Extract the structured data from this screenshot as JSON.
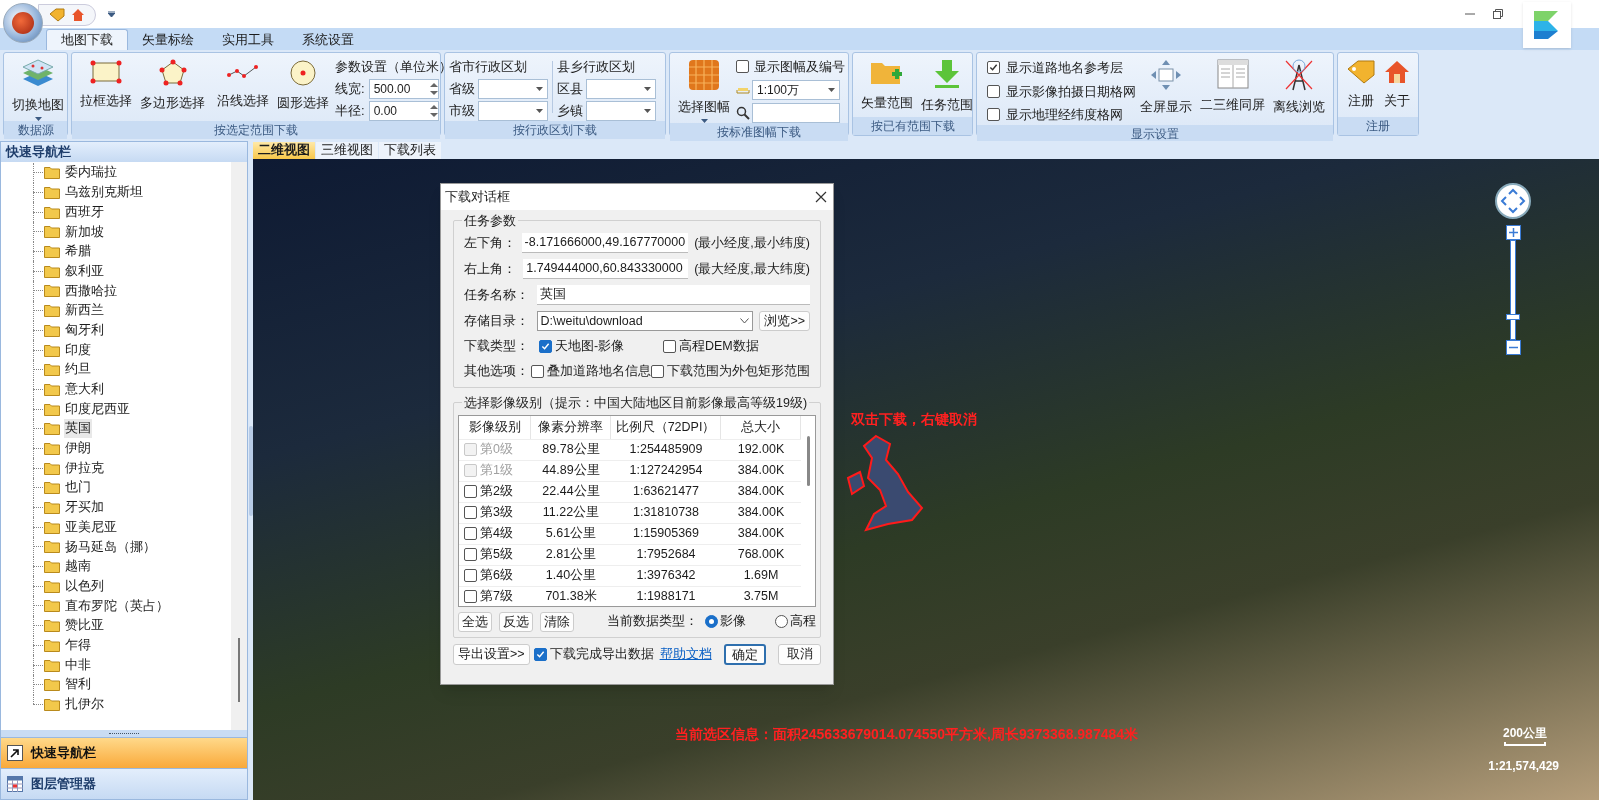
{
  "ribbon": {
    "tabs": [
      {
        "label": "地图下载",
        "selected": true
      },
      {
        "label": "矢量标绘",
        "selected": false
      },
      {
        "label": "实用工具",
        "selected": false
      },
      {
        "label": "系统设置",
        "selected": false
      }
    ],
    "data_source": {
      "title": "数据源",
      "switch_map": "切换地图"
    },
    "range_select": {
      "title": "按选定范围下载",
      "buttons": [
        "拉框选择",
        "多边形选择",
        "沿线选择",
        "圆形选择"
      ],
      "params_title": "参数设置（单位米）",
      "line_width": {
        "label": "线宽:",
        "value": "500.00"
      },
      "radius": {
        "label": "半径:",
        "value": "0.00"
      }
    },
    "admin": {
      "title": "按行政区划下载",
      "sections": [
        {
          "title": "省市行政区划",
          "fields": [
            "省级",
            "市级"
          ]
        },
        {
          "title": "县乡行政区划",
          "fields": [
            "区县",
            "乡镇"
          ]
        }
      ]
    },
    "sheet": {
      "title": "按标准图幅下载",
      "select_sheet": "选择图幅",
      "show_sheet": {
        "label": "显示图幅及编号",
        "checked": false
      },
      "scale": "1:100万"
    },
    "existing": {
      "title": "按已有范围下载",
      "buttons": [
        "矢量范围",
        "任务范围"
      ]
    },
    "display": {
      "title": "显示设置",
      "options": [
        {
          "label": "显示道路地名参考层",
          "checked": true
        },
        {
          "label": "显示影像拍摄日期格网",
          "checked": false
        },
        {
          "label": "显示地理经纬度格网",
          "checked": false
        }
      ],
      "buttons": [
        "全屏显示",
        "二三维同屏",
        "离线浏览"
      ]
    },
    "register": {
      "title": "注册",
      "buttons": [
        "注册",
        "关于"
      ]
    }
  },
  "sidebar": {
    "title": "快速导航栏",
    "tree": [
      {
        "label": "委内瑞拉",
        "selected": false
      },
      {
        "label": "乌兹别克斯坦",
        "selected": false
      },
      {
        "label": "西班牙",
        "selected": false
      },
      {
        "label": "新加坡",
        "selected": false
      },
      {
        "label": "希腊",
        "selected": false
      },
      {
        "label": "叙利亚",
        "selected": false
      },
      {
        "label": "西撒哈拉",
        "selected": false
      },
      {
        "label": "新西兰",
        "selected": false
      },
      {
        "label": "匈牙利",
        "selected": false
      },
      {
        "label": "印度",
        "selected": false
      },
      {
        "label": "约旦",
        "selected": false
      },
      {
        "label": "意大利",
        "selected": false
      },
      {
        "label": "印度尼西亚",
        "selected": false
      },
      {
        "label": "英国",
        "selected": true
      },
      {
        "label": "伊朗",
        "selected": false
      },
      {
        "label": "伊拉克",
        "selected": false
      },
      {
        "label": "也门",
        "selected": false
      },
      {
        "label": "牙买加",
        "selected": false
      },
      {
        "label": "亚美尼亚",
        "selected": false
      },
      {
        "label": "扬马延岛（挪）",
        "selected": false
      },
      {
        "label": "越南",
        "selected": false
      },
      {
        "label": "以色列",
        "selected": false
      },
      {
        "label": "直布罗陀（英占）",
        "selected": false
      },
      {
        "label": "赞比亚",
        "selected": false
      },
      {
        "label": "乍得",
        "selected": false
      },
      {
        "label": "中非",
        "selected": false
      },
      {
        "label": "智利",
        "selected": false
      },
      {
        "label": "扎伊尔",
        "selected": false
      }
    ],
    "panels": [
      {
        "label": "快速导航栏",
        "selected": true
      },
      {
        "label": "图层管理器",
        "selected": false
      }
    ]
  },
  "view_tabs": [
    {
      "label": "二维视图",
      "selected": true
    },
    {
      "label": "三维视图",
      "selected": false
    },
    {
      "label": "下载列表",
      "selected": false
    }
  ],
  "map": {
    "hint": "双击下载，右键取消",
    "selection_info": "当前选区信息：面积245633679014.074550平方米,周长9373368.987484米",
    "scale_bar": "200公里",
    "scale": "1:21,574,429",
    "zoom": {
      "level": 0.22
    }
  },
  "dialog": {
    "title": "下载对话框",
    "task_group": "任务参数",
    "corners": [
      {
        "label": "左下角：",
        "value": "-8.171666000,49.167770000",
        "hint": "(最小经度,最小纬度)"
      },
      {
        "label": "右上角：",
        "value": "1.749444000,60.843330000",
        "hint": "(最大经度,最大纬度)"
      }
    ],
    "task_name": {
      "label": "任务名称：",
      "value": "英国"
    },
    "directory": {
      "label": "存储目录：",
      "value": "D:\\weitu\\download",
      "browse": "浏览>>"
    },
    "download_type": {
      "label": "下载类型：",
      "options": [
        {
          "label": "天地图-影像",
          "checked": true
        },
        {
          "label": "高程DEM数据",
          "checked": false
        }
      ]
    },
    "other_options": {
      "label": "其他选项：",
      "options": [
        {
          "label": "叠加道路地名信息",
          "checked": false
        },
        {
          "label": "下载范围为外包矩形范围",
          "checked": false
        }
      ]
    },
    "level_group": "选择影像级别（提示：中国大陆地区目前影像最高等级19级)",
    "columns": [
      "影像级别",
      "像素分辨率",
      "比例尺（72DPI）",
      "总大小"
    ],
    "levels": [
      {
        "name": "第0级",
        "resolution": "89.78公里",
        "scale": "1:254485909",
        "size": "192.00K",
        "checked": false,
        "disabled": true
      },
      {
        "name": "第1级",
        "resolution": "44.89公里",
        "scale": "1:127242954",
        "size": "384.00K",
        "checked": false,
        "disabled": true
      },
      {
        "name": "第2级",
        "resolution": "22.44公里",
        "scale": "1:63621477",
        "size": "384.00K",
        "checked": false,
        "disabled": false
      },
      {
        "name": "第3级",
        "resolution": "11.22公里",
        "scale": "1:31810738",
        "size": "384.00K",
        "checked": false,
        "disabled": false
      },
      {
        "name": "第4级",
        "resolution": "5.61公里",
        "scale": "1:15905369",
        "size": "384.00K",
        "checked": false,
        "disabled": false
      },
      {
        "name": "第5级",
        "resolution": "2.81公里",
        "scale": "1:7952684",
        "size": "768.00K",
        "checked": false,
        "disabled": false
      },
      {
        "name": "第6级",
        "resolution": "1.40公里",
        "scale": "1:3976342",
        "size": "1.69M",
        "checked": false,
        "disabled": false
      },
      {
        "name": "第7级",
        "resolution": "701.38米",
        "scale": "1:1988171",
        "size": "3.75M",
        "checked": false,
        "disabled": false
      }
    ],
    "select_buttons": [
      "全选",
      "反选",
      "清除"
    ],
    "data_type": {
      "label": "当前数据类型：",
      "options": [
        {
          "label": "影像",
          "selected": true
        },
        {
          "label": "高程",
          "selected": false
        }
      ]
    },
    "export_settings": "导出设置>>",
    "export_after": {
      "label": "下载完成导出数据",
      "checked": true
    },
    "help": "帮助文档",
    "ok": "确定",
    "cancel": "取消"
  }
}
